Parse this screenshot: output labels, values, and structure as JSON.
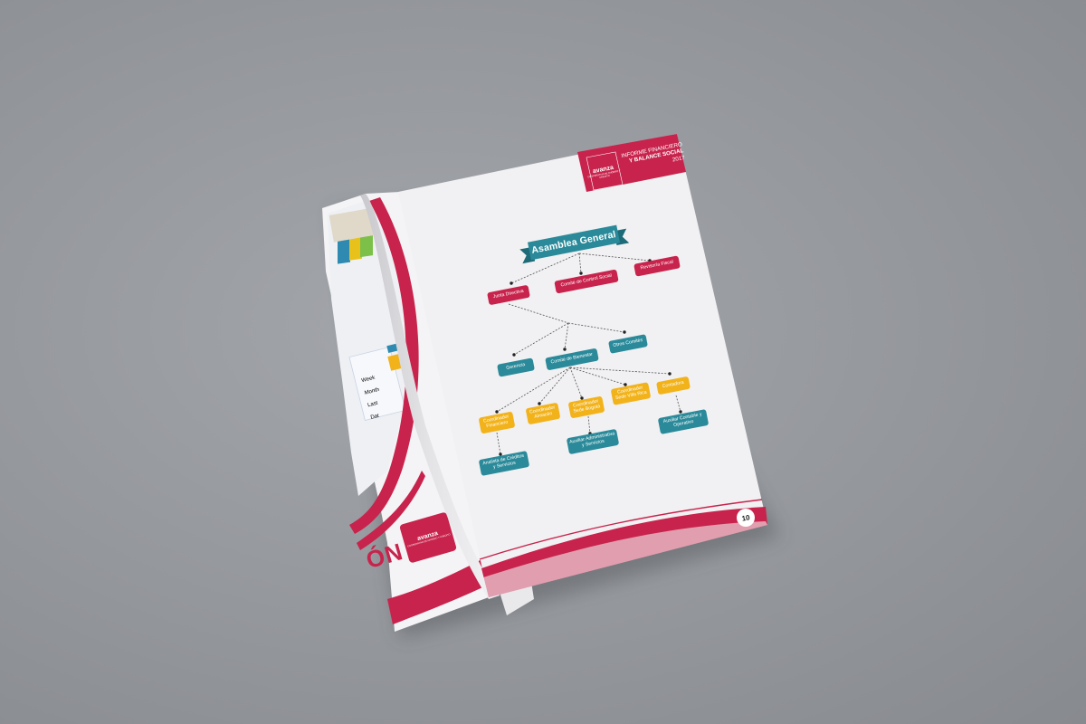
{
  "header": {
    "line1": "INFORME FINANCIERO",
    "line2": "Y BALANCE SOCIAL",
    "line3": "2017",
    "brand": "avanza",
    "brand_sub": "COOPERATIVA DE AHORRO Y CREDITO"
  },
  "page_number": "10",
  "left_page": {
    "title_fragment": "ÓN",
    "brand": "avanza",
    "brand_sub": "COOPERATIVA DE AHORRO Y CREDITO",
    "mini_labels": [
      "Week",
      "Month",
      "Last",
      "Dat"
    ]
  },
  "colors": {
    "background": "#94979c",
    "brand_red": "#c8234c",
    "teal": "#2a8a9a",
    "yellow": "#f2b21a",
    "paper": "#f1f0f2"
  },
  "org_chart": {
    "root": "Asamblea General",
    "nodes": [
      {
        "id": "junta",
        "label": "Junta Directiva"
      },
      {
        "id": "control",
        "label": "Comité de Control Social"
      },
      {
        "id": "revisoria",
        "label": "Revisoría Fiscal"
      },
      {
        "id": "gerencia",
        "label": "Gerencia"
      },
      {
        "id": "bienestar",
        "label": "Comité de Bienestar"
      },
      {
        "id": "otros",
        "label": "Otros Comités"
      },
      {
        "id": "coord_fin",
        "label": "Coordinador\nFinanciero"
      },
      {
        "id": "coord_alm",
        "label": "Coordinador\nAlmacén"
      },
      {
        "id": "coord_bog",
        "label": "Coordinador\nSede Bogotá"
      },
      {
        "id": "coord_vil",
        "label": "Coordinador\nSede Villa Rica"
      },
      {
        "id": "contadora",
        "label": "Contadora"
      },
      {
        "id": "analista",
        "label": "Analista de Créditos\ny Servicios"
      },
      {
        "id": "aux_admin",
        "label": "Auxiliar Administrativa\ny Servicios"
      },
      {
        "id": "aux_cont",
        "label": "Auxiliar Contable y\nOperativo"
      }
    ]
  }
}
